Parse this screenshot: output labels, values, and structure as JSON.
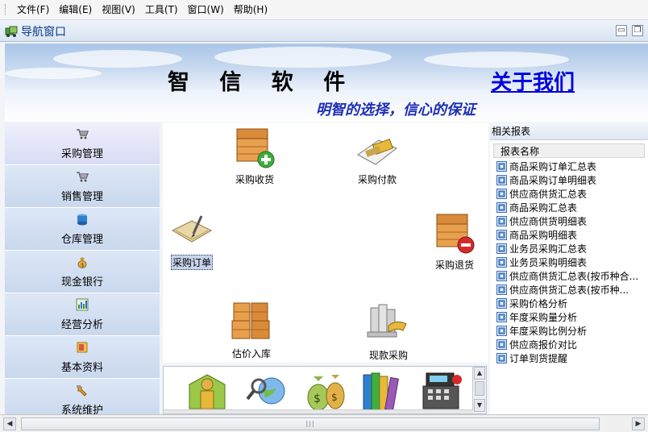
{
  "menu": [
    {
      "label": "文件(F)"
    },
    {
      "label": "编辑(E)"
    },
    {
      "label": "视图(V)"
    },
    {
      "label": "工具(T)"
    },
    {
      "label": "窗口(W)"
    },
    {
      "label": "帮助(H)"
    }
  ],
  "window": {
    "title": "导航窗口",
    "minimize_glyph": "▭",
    "restore_glyph": "❐"
  },
  "banner": {
    "brand": "智 信 软 件",
    "about_link": "关于我们",
    "slogan": "明智的选择，信心的保证"
  },
  "sidebar": {
    "items": [
      {
        "label": "采购管理",
        "icon": "cart-icon",
        "active": true
      },
      {
        "label": "销售管理",
        "icon": "cart-icon",
        "active": false
      },
      {
        "label": "仓库管理",
        "icon": "warehouse-icon",
        "active": false
      },
      {
        "label": "现金银行",
        "icon": "money-bag-icon",
        "active": false
      },
      {
        "label": "经营分析",
        "icon": "bar-chart-icon",
        "active": false
      },
      {
        "label": "基本资料",
        "icon": "folder-icon",
        "active": false
      },
      {
        "label": "系统维护",
        "icon": "wrench-icon",
        "active": false
      }
    ]
  },
  "workspace": {
    "functions": [
      {
        "label": "采购收货",
        "icon": "box-plus-icon"
      },
      {
        "label": "采购付款",
        "icon": "payment-card-icon"
      },
      {
        "label": "采购订单",
        "icon": "order-doc-icon",
        "selected": true
      },
      {
        "label": "采购退货",
        "icon": "box-minus-icon"
      },
      {
        "label": "估价入库",
        "icon": "stacked-boxes-icon"
      },
      {
        "label": "现款采购",
        "icon": "cash-hand-icon"
      }
    ],
    "shortcuts": [
      {
        "icon": "user-green-icon"
      },
      {
        "icon": "globe-search-icon"
      },
      {
        "icon": "money-bags-icon"
      },
      {
        "icon": "books-icon"
      },
      {
        "icon": "cash-register-icon"
      }
    ]
  },
  "reports": {
    "title": "相关报表",
    "column": "报表名称",
    "items": [
      "商品采购订单汇总表",
      "商品采购订单明细表",
      "供应商供货汇总表",
      "商品采购汇总表",
      "供应商供货明细表",
      "商品采购明细表",
      "业务员采购汇总表",
      "业务员采购明细表",
      "供应商供货汇总表(按币种合...",
      "供应商供货汇总表(按币种...",
      "采购价格分析",
      "年度采购量分析",
      "年度采购比例分析",
      "供应商报价对比",
      "订单到货提醒"
    ]
  },
  "colors": {
    "accent": "#0b3a8a",
    "link": "#0000dd",
    "slogan": "#1f2fb5",
    "sidebar_bg": "#c9d8ee"
  }
}
